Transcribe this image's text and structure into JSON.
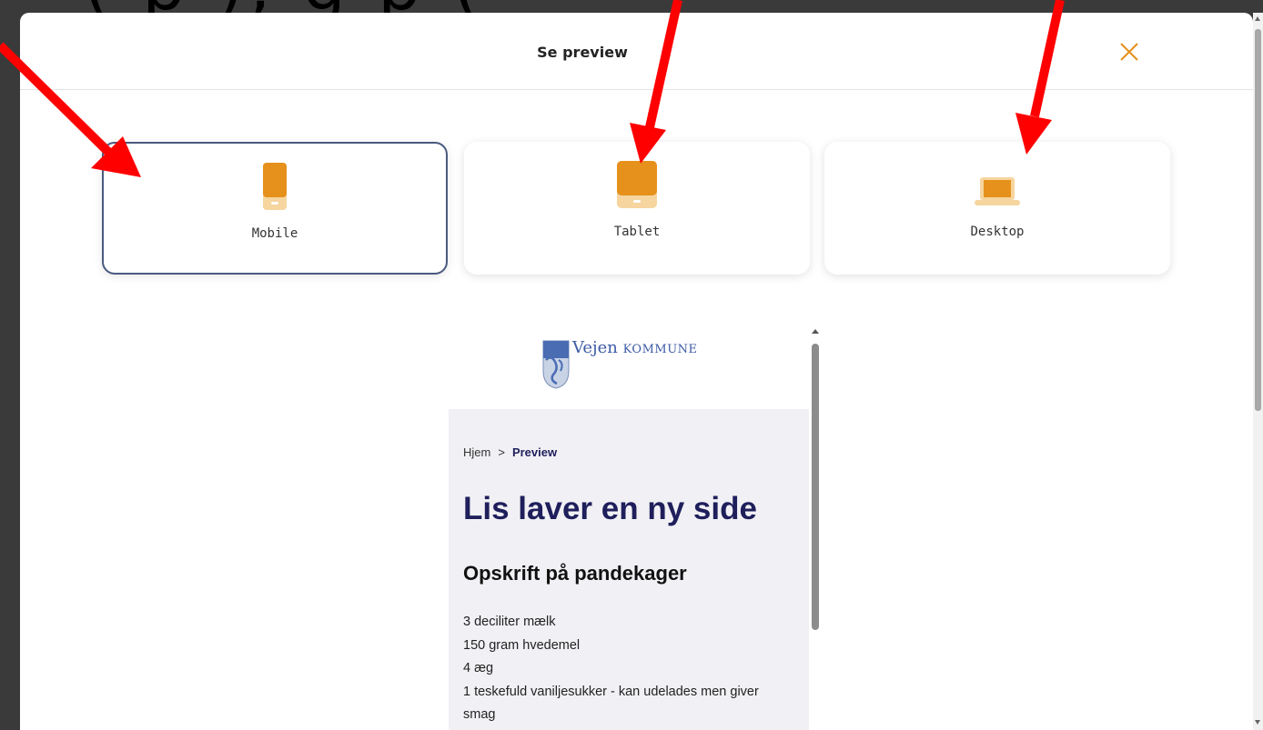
{
  "modal": {
    "title": "Se preview",
    "close_icon": "close-icon",
    "accent_color": "#e5911c"
  },
  "devices": [
    {
      "label": "Mobile",
      "icon": "mobile-icon",
      "selected": true
    },
    {
      "label": "Tablet",
      "icon": "tablet-icon",
      "selected": false
    },
    {
      "label": "Desktop",
      "icon": "desktop-icon",
      "selected": false
    }
  ],
  "preview": {
    "logo_name": "Vejen",
    "logo_suffix": "KOMMUNE",
    "breadcrumb": {
      "home": "Hjem",
      "separator": ">",
      "current": "Preview"
    },
    "title": "Lis laver en ny side",
    "subtitle": "Opskrift på pandekager",
    "ingredients": [
      "3 deciliter mælk",
      "150 gram hvedemel",
      "4 æg",
      "1 teskefuld vaniljesukker - kan udelades men giver smag"
    ]
  },
  "annotation": {
    "overlay_text": "(           p       ),           g           p  (",
    "arrow_color": "#ff0000"
  }
}
